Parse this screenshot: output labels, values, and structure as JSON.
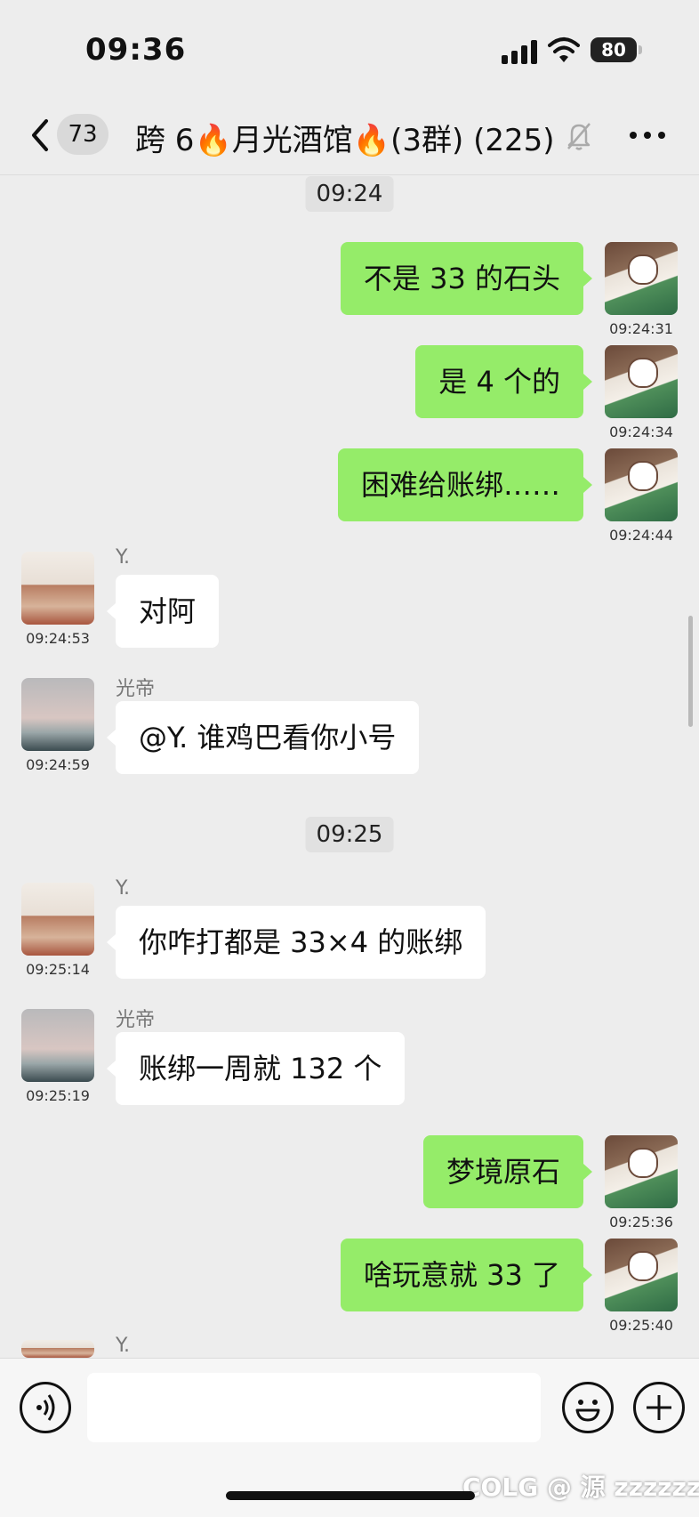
{
  "status": {
    "time": "09:36",
    "battery": "80"
  },
  "nav": {
    "unread_count": "73",
    "title": "跨 6🔥月光酒馆🔥(3群) (225)"
  },
  "messages": [
    {
      "kind": "timestamp",
      "text": "09:24"
    },
    {
      "kind": "me",
      "text": "不是 33 的石头",
      "time": "09:24:31"
    },
    {
      "kind": "me",
      "text": "是 4 个的",
      "time": "09:24:34"
    },
    {
      "kind": "me",
      "text": "困难给账绑……",
      "time": "09:24:44"
    },
    {
      "kind": "other",
      "sender": "Y.",
      "text": "对阿",
      "time": "09:24:53"
    },
    {
      "kind": "other",
      "sender": "光帝",
      "text": "@Y. 谁鸡巴看你小号",
      "time": "09:24:59"
    },
    {
      "kind": "timestamp",
      "text": "09:25"
    },
    {
      "kind": "other",
      "sender": "Y.",
      "text": "你咋打都是 33×4 的账绑",
      "time": "09:25:14"
    },
    {
      "kind": "other",
      "sender": "光帝",
      "text": "账绑一周就 132 个",
      "time": "09:25:19"
    },
    {
      "kind": "me",
      "text": "梦境原石",
      "time": "09:25:36"
    },
    {
      "kind": "me",
      "text": "啥玩意就 33 了",
      "time": "09:25:40"
    },
    {
      "kind": "other_partial",
      "sender": "Y."
    }
  ],
  "input": {
    "placeholder": ""
  },
  "watermark": "COLG @ 源 zzzzzzz",
  "icons": {
    "back": "chevron-left-icon",
    "mute": "bell-slash-icon",
    "more": "more-icon",
    "voice": "voice-icon",
    "emoji": "emoji-icon",
    "plus": "plus-icon"
  },
  "colors": {
    "bubble_me": "#95ec69",
    "bubble_other": "#ffffff",
    "background": "#ededed"
  }
}
